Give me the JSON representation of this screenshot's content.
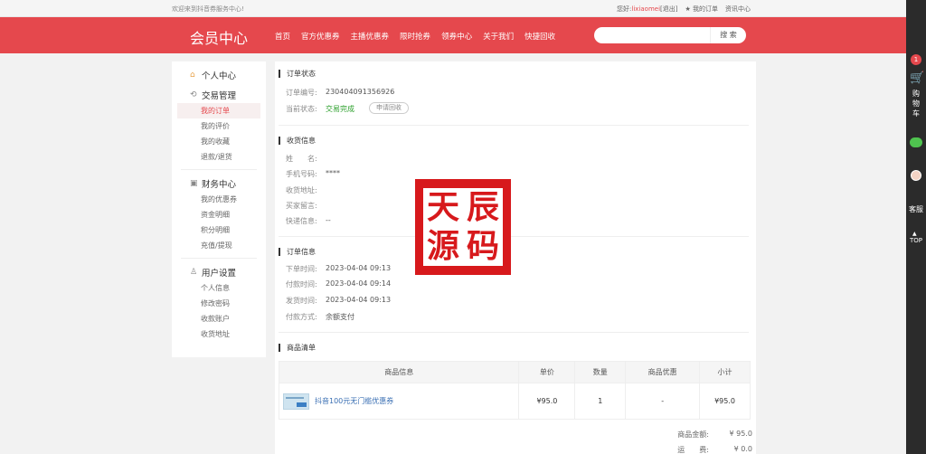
{
  "topbar": {
    "welcome": "欢迎来到抖音券服务中心!",
    "greeting": "您好:",
    "username": "lixiaomei",
    "logout": "[退出]",
    "my_orders": "★ 我的订单",
    "news": "资讯中心"
  },
  "header": {
    "logo": "会员中心",
    "nav": [
      "首页",
      "官方优惠券",
      "主播优惠券",
      "限时抢券",
      "领券中心",
      "关于我们",
      "快捷回收"
    ],
    "search_placeholder": "",
    "search_button": "搜 索"
  },
  "sidebar": {
    "personal_center": "个人中心",
    "trade": {
      "title": "交易管理",
      "items": [
        "我的订单",
        "我的评价",
        "我的收藏",
        "退款/退货"
      ]
    },
    "finance": {
      "title": "财务中心",
      "items": [
        "我的优惠券",
        "资金明细",
        "积分明细",
        "充值/提现"
      ]
    },
    "settings": {
      "title": "用户设置",
      "items": [
        "个人信息",
        "修改密码",
        "收款账户",
        "收货地址"
      ]
    }
  },
  "order_status": {
    "title": "订单状态",
    "order_no_label": "订单编号:",
    "order_no": "230404091356926",
    "status_label": "当前状态:",
    "status": "交易完成",
    "refund_button": "申请回收"
  },
  "shipping": {
    "title": "收货信息",
    "name_label": "姓　　名:",
    "name": "",
    "phone_label": "手机号码:",
    "phone": "****",
    "address_label": "收货地址:",
    "address": "",
    "message_label": "买家留言:",
    "message": "",
    "express_label": "快递信息:",
    "express": "--"
  },
  "order_info": {
    "title": "订单信息",
    "order_time_label": "下单时间:",
    "order_time": "2023-04-04 09:13",
    "pay_time_label": "付款时间:",
    "pay_time": "2023-04-04 09:14",
    "ship_time_label": "发货时间:",
    "ship_time": "2023-04-04 09:13",
    "pay_method_label": "付款方式:",
    "pay_method": "余额支付"
  },
  "products": {
    "title": "商品清单",
    "headers": [
      "商品信息",
      "单价",
      "数量",
      "商品优惠",
      "小计"
    ],
    "rows": [
      {
        "name": "抖音100元无门槛优惠券",
        "price": "¥95.0",
        "qty": "1",
        "discount": "-",
        "subtotal": "¥95.0"
      }
    ]
  },
  "summary": {
    "amount_label": "商品金额:",
    "amount": "¥ 95.0",
    "shipping_label": "运　　费:",
    "shipping": "¥ 0.0"
  },
  "watermark": [
    "天",
    "辰",
    "源",
    "码"
  ],
  "rbar": {
    "cart_count": "1",
    "cart_label": "购物车",
    "service_label": "客服",
    "top_label": "TOP"
  }
}
